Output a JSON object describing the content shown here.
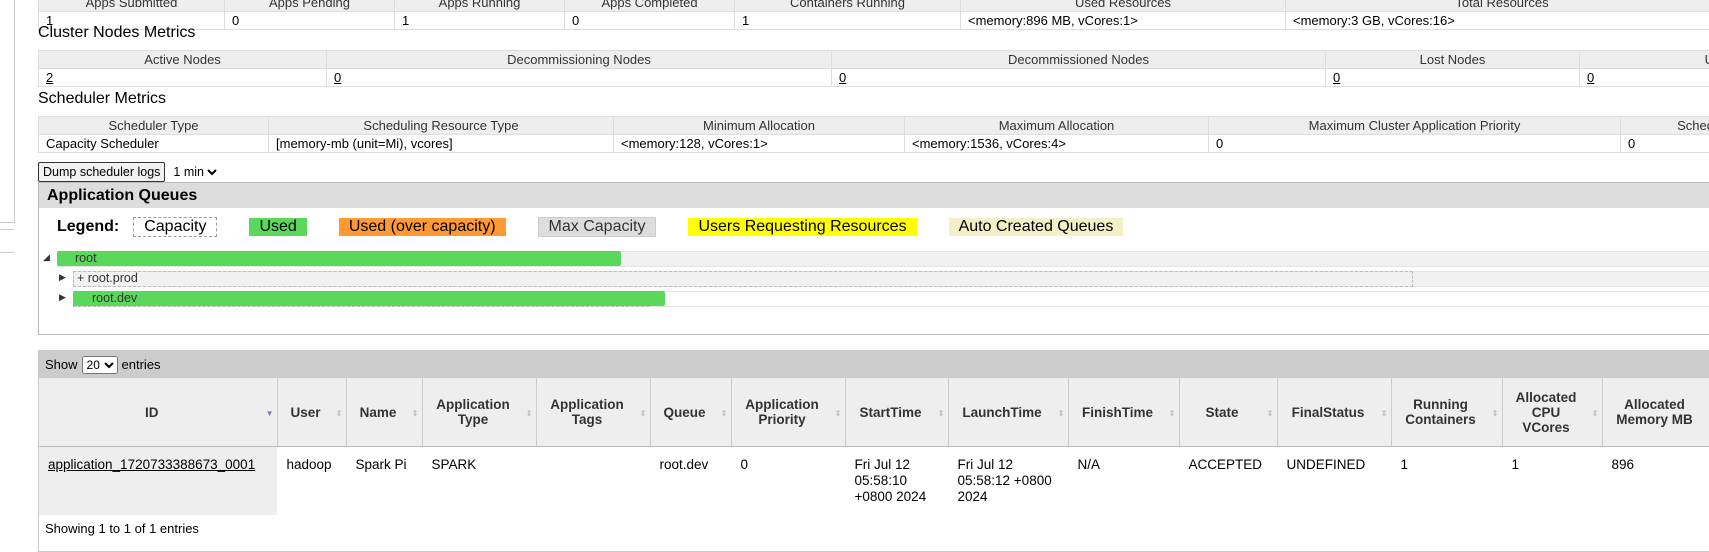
{
  "cluster_metrics_row": {
    "headers": [
      "Apps Submitted",
      "Apps Pending",
      "Apps Running",
      "Apps Completed",
      "Containers Running",
      "Used Resources",
      "Total Resources"
    ],
    "values": [
      "1",
      "0",
      "1",
      "0",
      "1",
      "<memory:896 MB, vCores:1>",
      "<memory:3 GB, vCores:16>"
    ]
  },
  "nodes_metrics": {
    "title": "Cluster Nodes Metrics",
    "headers": [
      "Active Nodes",
      "Decommissioning Nodes",
      "Decommissioned Nodes",
      "Lost Nodes",
      "U"
    ],
    "values": [
      "2",
      "0",
      "0",
      "0",
      "0",
      ""
    ]
  },
  "scheduler_metrics": {
    "title": "Scheduler Metrics",
    "headers": [
      "Scheduler Type",
      "Scheduling Resource Type",
      "Minimum Allocation",
      "Maximum Allocation",
      "Maximum Cluster Application Priority",
      "Sched"
    ],
    "values": [
      "Capacity Scheduler",
      "[memory-mb (unit=Mi), vcores]",
      "<memory:128, vCores:1>",
      "<memory:1536, vCores:4>",
      "0",
      "0"
    ]
  },
  "controls": {
    "dump_label": "Dump scheduler logs",
    "interval": "1 min"
  },
  "queues": {
    "title": "Application Queues",
    "legend_label": "Legend:",
    "legend": [
      "Capacity",
      "Used",
      "Used (over capacity)",
      "Max Capacity",
      "Users Requesting Resources",
      "Auto Created Queues"
    ],
    "items": [
      {
        "name": "root",
        "expanded": true,
        "used_fraction": 0.34
      },
      {
        "name": "+ root.prod",
        "expanded": false,
        "used_fraction": 0
      },
      {
        "name": "root.dev",
        "expanded": false,
        "used_fraction": 0.36
      }
    ]
  },
  "apps": {
    "show_label": "Show",
    "entries_count": "20",
    "entries_label": "entries",
    "columns": [
      "ID",
      "User",
      "Name",
      "Application Type",
      "Application Tags",
      "Queue",
      "Application Priority",
      "StartTime",
      "LaunchTime",
      "FinishTime",
      "State",
      "FinalStatus",
      "Running Containers",
      "Allocated CPU VCores",
      "Allocated Memory MB"
    ],
    "rows": [
      [
        "application_1720733388673_0001",
        "hadoop",
        "Spark Pi",
        "SPARK",
        "",
        "root.dev",
        "0",
        "Fri Jul 12 05:58:10 +0800 2024",
        "Fri Jul 12 05:58:12 +0800 2024",
        "N/A",
        "ACCEPTED",
        "UNDEFINED",
        "1",
        "1",
        "896"
      ]
    ],
    "showing": "Showing 1 to 1 of 1 entries"
  }
}
